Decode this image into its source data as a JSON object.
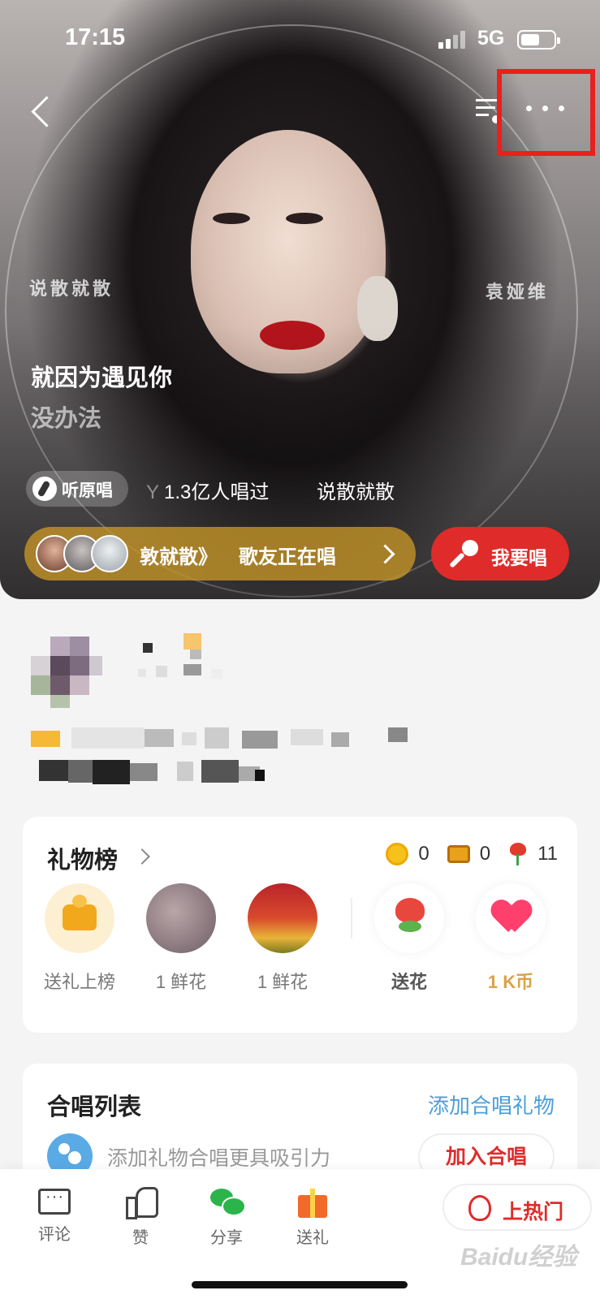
{
  "status_bar": {
    "time": "17:15",
    "network": "5G"
  },
  "hero": {
    "cover_text_left": "说散就散",
    "cover_text_right": "袁娅维",
    "lyrics": {
      "current": "就因为遇见你",
      "next": "没办法"
    },
    "original_vocals_label": "听原唱",
    "sung_count": "1.3亿人唱过",
    "song_name": "说散就散",
    "singing_bar": {
      "song_fragment": "敦就散》",
      "status": "歌友正在唱"
    },
    "sing_button_label": "我要唱",
    "icons": {
      "back": "back-arrow-icon",
      "playlist": "playlist-icon",
      "more": "more-dots-icon"
    },
    "highlight_color": "#e8201f"
  },
  "gift_board": {
    "title": "礼物榜",
    "stats": {
      "coins": "0",
      "chests": "0",
      "flowers": "11"
    },
    "items": [
      {
        "label": "送礼上榜"
      },
      {
        "label": "1 鲜花"
      },
      {
        "label": "1 鲜花"
      }
    ],
    "send_flower_label": "送花",
    "coin_gift_label": "1 K币"
  },
  "chorus": {
    "title": "合唱列表",
    "add_gift_link": "添加合唱礼物",
    "description": "添加礼物合唱更具吸引力",
    "join_button": "加入合唱"
  },
  "bottom_bar": {
    "items": [
      {
        "label": "评论",
        "icon": "comment-icon"
      },
      {
        "label": "赞",
        "icon": "like-icon"
      },
      {
        "label": "分享",
        "icon": "wechat-share-icon"
      },
      {
        "label": "送礼",
        "icon": "gift-icon"
      }
    ],
    "hot_button": "上热门"
  },
  "watermark": "Baidu经验",
  "colors": {
    "accent_red": "#e02b2b",
    "link_blue": "#4c9fd8",
    "gold": "#d9a24a"
  }
}
